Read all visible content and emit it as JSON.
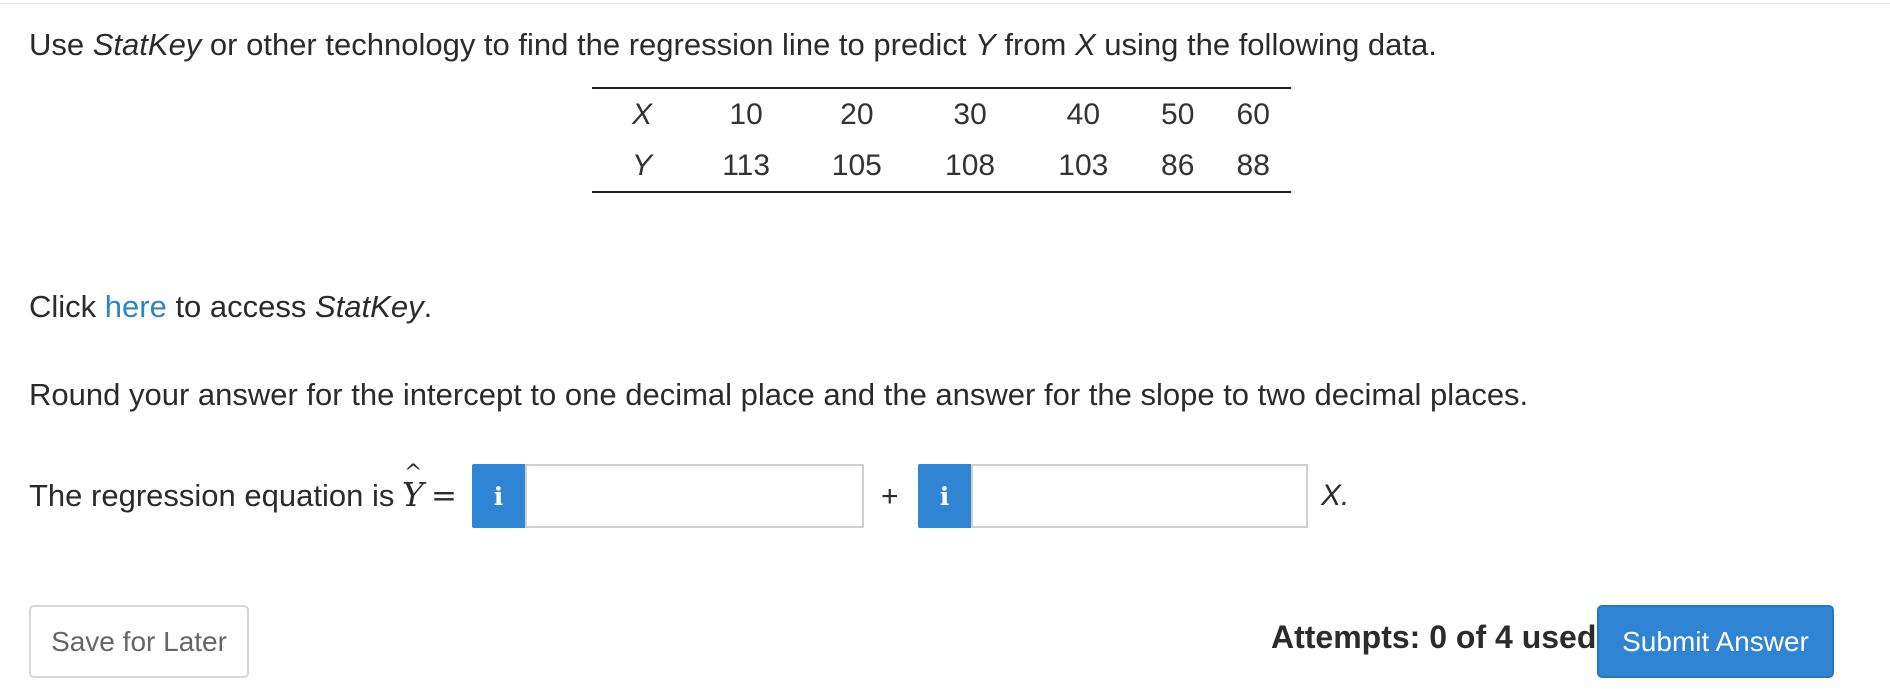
{
  "question": {
    "part1": "Use ",
    "statkey": "StatKey",
    "part2": " or other technology to find the regression line to predict ",
    "y": "Y",
    "part3": " from ",
    "x": "X",
    "part4": " using the following data."
  },
  "table": {
    "rows": [
      {
        "label": "X",
        "values": [
          "10",
          "20",
          "30",
          "40",
          "50",
          "60"
        ]
      },
      {
        "label": "Y",
        "values": [
          "113",
          "105",
          "108",
          "103",
          "86",
          "88"
        ]
      }
    ]
  },
  "click": {
    "prefix": "Click ",
    "link": "here",
    "middle": " to access ",
    "statkey": "StatKey",
    "suffix": "."
  },
  "instructions": "Round your answer for the intercept to one decimal place and the answer for the slope to two decimal places.",
  "equation": {
    "label": "The regression equation is ",
    "hat": "^",
    "yhat": "Y",
    "equals": "=",
    "info_icon_glyph": "i",
    "intercept_value": "",
    "plus": "+",
    "slope_value": "",
    "x_term": "X."
  },
  "footer": {
    "save_label": "Save for Later",
    "attempts": "Attempts: 0 of 4 used",
    "submit_label": "Submit Answer"
  },
  "colors": {
    "accent": "#2f84d3",
    "link": "#2f84c6"
  }
}
